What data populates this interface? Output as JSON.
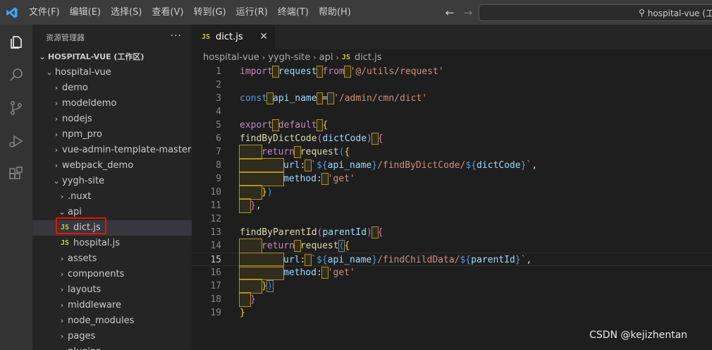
{
  "menu": [
    "文件(F)",
    "编辑(E)",
    "选择(S)",
    "查看(V)",
    "转到(G)",
    "运行(R)",
    "终端(T)",
    "帮助(H)"
  ],
  "search": {
    "text": "hospital-vue (工"
  },
  "sidebar": {
    "title": "资源管理器",
    "more": "···",
    "tree": [
      {
        "label": "HOSPITAL-VUE (工作区)",
        "chev": "⌄",
        "indent": 6,
        "bold": true,
        "type": "folder"
      },
      {
        "label": "hospital-vue",
        "chev": "⌄",
        "indent": 16,
        "type": "folder"
      },
      {
        "label": "demo",
        "chev": "›",
        "indent": 26,
        "type": "folder"
      },
      {
        "label": "modeldemo",
        "chev": "›",
        "indent": 26,
        "type": "folder"
      },
      {
        "label": "nodejs",
        "chev": "›",
        "indent": 26,
        "type": "folder"
      },
      {
        "label": "npm_pro",
        "chev": "›",
        "indent": 26,
        "type": "folder"
      },
      {
        "label": "vue-admin-template-master",
        "chev": "›",
        "indent": 26,
        "type": "folder"
      },
      {
        "label": "webpack_demo",
        "chev": "›",
        "indent": 26,
        "type": "folder"
      },
      {
        "label": "yygh-site",
        "chev": "⌄",
        "indent": 26,
        "type": "folder"
      },
      {
        "label": ".nuxt",
        "chev": "›",
        "indent": 34,
        "type": "folder"
      },
      {
        "label": "api",
        "chev": "⌄",
        "indent": 34,
        "type": "folder"
      },
      {
        "label": "dict.js",
        "indent": 40,
        "type": "file",
        "selected": true
      },
      {
        "label": "hospital.js",
        "indent": 40,
        "type": "file"
      },
      {
        "label": "assets",
        "chev": "›",
        "indent": 34,
        "type": "folder"
      },
      {
        "label": "components",
        "chev": "›",
        "indent": 34,
        "type": "folder"
      },
      {
        "label": "layouts",
        "chev": "›",
        "indent": 34,
        "type": "folder"
      },
      {
        "label": "middleware",
        "chev": "›",
        "indent": 34,
        "type": "folder"
      },
      {
        "label": "node_modules",
        "chev": "›",
        "indent": 34,
        "type": "folder"
      },
      {
        "label": "pages",
        "chev": "›",
        "indent": 34,
        "type": "folder"
      },
      {
        "label": "plugins",
        "chev": "›",
        "indent": 34,
        "type": "folder"
      }
    ]
  },
  "editor": {
    "tab_label": "dict.js",
    "tab_icon": "JS",
    "close": "✕",
    "breadcrumb": [
      "hospital-vue",
      "yygh-site",
      "api",
      "dict.js"
    ],
    "current_line": 15,
    "line_numbers": [
      "1",
      "2",
      "3",
      "4",
      "5",
      "6",
      "7",
      "8",
      "9",
      "10",
      "11",
      "12",
      "13",
      "14",
      "15",
      "16",
      "17",
      "18",
      "19"
    ],
    "code": {
      "l1": {
        "kw": "import",
        "a": "request",
        "kw2": "from",
        "str": "'@/utils/request'"
      },
      "l3": {
        "kw": "const",
        "var": "api_name",
        "op": "=",
        "str": "'/admin/cmn/dict'"
      },
      "l5": {
        "kw": "export",
        "kw2": "default",
        "brace": "{"
      },
      "l6": {
        "fn": "findByDictCode",
        "param": "dictCode"
      },
      "l7": {
        "kw": "return",
        "fn": "request"
      },
      "l8": {
        "key": "url",
        "str1": "`",
        "interp1": "api_name",
        "str2": "/findByDictCode/",
        "interp2": "dictCode"
      },
      "l9": {
        "key": "method",
        "str": "'get'"
      },
      "l13": {
        "fn": "findByParentId",
        "param": "parentId"
      },
      "l14": {
        "kw": "return",
        "fn": "request"
      },
      "l15": {
        "key": "url",
        "str1": "`",
        "interp1": "api_name",
        "str2": "/findChildData/",
        "interp2": "parentId"
      },
      "l16": {
        "key": "method",
        "str": "'get'"
      }
    }
  },
  "watermark": "CSDN @kejizhentan",
  "colors": {
    "accent_red": "#e51400",
    "js_icon": "#cbcb41",
    "whitespace_highlight": "#b3911d"
  }
}
